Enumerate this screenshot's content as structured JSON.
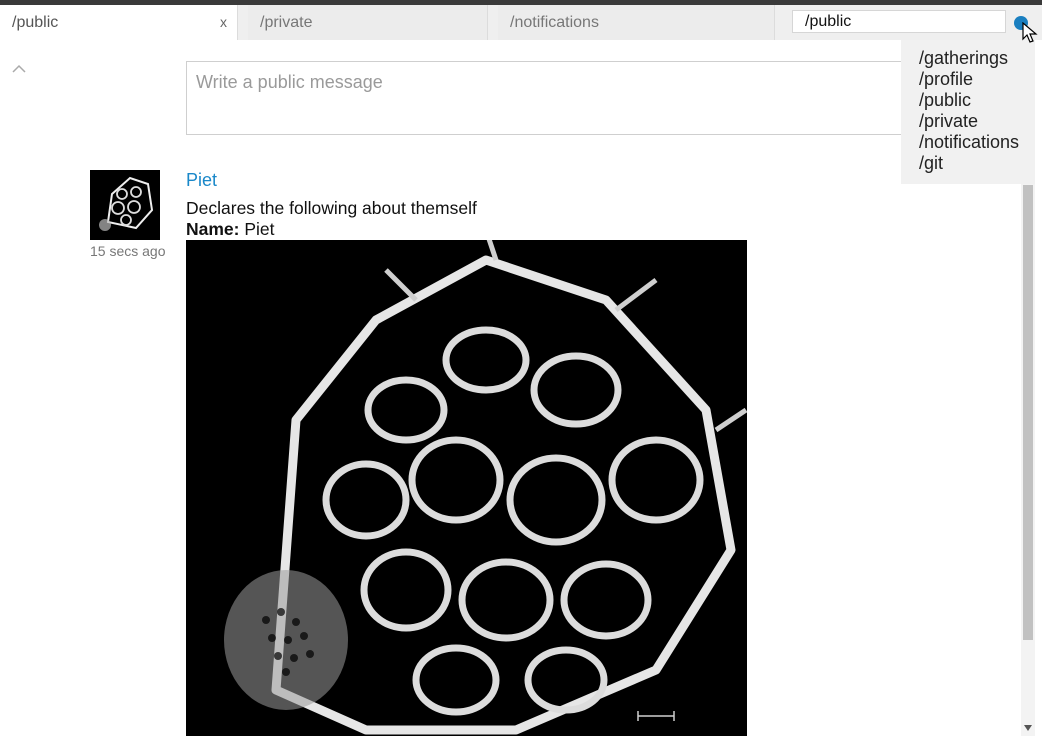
{
  "tabs": [
    {
      "label": "/public",
      "active": true,
      "close_label": "x"
    },
    {
      "label": "/private",
      "active": false
    },
    {
      "label": "/notifications",
      "active": false
    }
  ],
  "url_input": {
    "value": "/public"
  },
  "composer": {
    "placeholder": "Write a public message"
  },
  "post": {
    "author": "Piet",
    "timestamp": "15 secs ago",
    "text": "Declares the following about themself",
    "name_label": "Name:",
    "name_value": "Piet"
  },
  "suggestions": [
    "/gatherings",
    "/profile",
    "/public",
    "/private",
    "/notifications",
    "/git"
  ],
  "colors": {
    "accent": "#1a88c9",
    "status_dot": "#1a7fc0",
    "dropdown_bg": "#f1f1f1"
  },
  "icons": {
    "collapse": "chevron-up-icon",
    "status": "status-dot-icon",
    "cursor": "mouse-pointer-icon"
  }
}
